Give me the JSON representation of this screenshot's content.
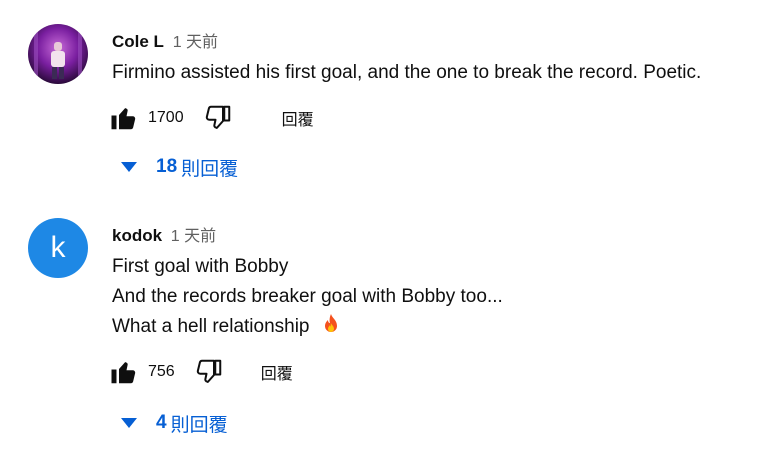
{
  "comments": [
    {
      "author": "Cole L",
      "time": "1 天前",
      "lines": [
        "Firmino assisted his first goal, and the one to break the record. Poetic."
      ],
      "likes": "1700",
      "reply_label": "回覆",
      "replies_count": "18",
      "replies_label": "則回覆",
      "avatar": "photo-avatar"
    },
    {
      "author": "kodok",
      "time": "1 天前",
      "lines": [
        "First goal with Bobby",
        "And the records breaker goal with Bobby too...",
        "What a hell relationship"
      ],
      "emoji": "fire-emoji",
      "likes": "756",
      "reply_label": "回覆",
      "replies_count": "4",
      "replies_label": "則回覆",
      "avatar_letter": "k",
      "avatar_color": "#1e88e5"
    }
  ],
  "colors": {
    "link": "#065fd4",
    "text": "#0f0f0f",
    "muted": "#606060"
  }
}
